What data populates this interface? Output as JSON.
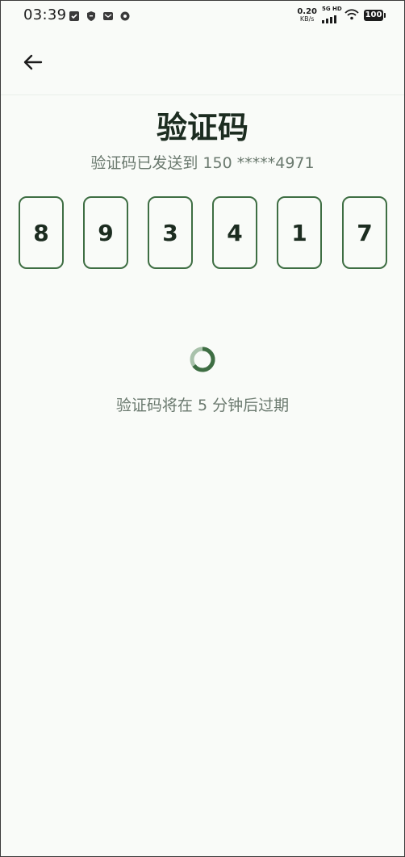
{
  "status_bar": {
    "time": "03:39",
    "net_speed_value": "0.20",
    "net_speed_unit": "KB/s",
    "signal_label": "5G HD",
    "battery": "100",
    "left_icons": [
      "shield-check-icon",
      "shield-icon",
      "mail-icon",
      "settings-icon"
    ]
  },
  "header": {
    "back_icon": "arrow-left-icon"
  },
  "main": {
    "title": "验证码",
    "subtitle": "验证码已发送到 150 *****4971",
    "code_digits": [
      "8",
      "9",
      "3",
      "4",
      "1",
      "7"
    ],
    "expiry_text": "验证码将在 5 分钟后过期"
  },
  "colors": {
    "accent": "#3e6e43",
    "background": "#f9fbf8",
    "text_primary": "#1c2c20",
    "text_secondary": "#6b7a6f"
  }
}
